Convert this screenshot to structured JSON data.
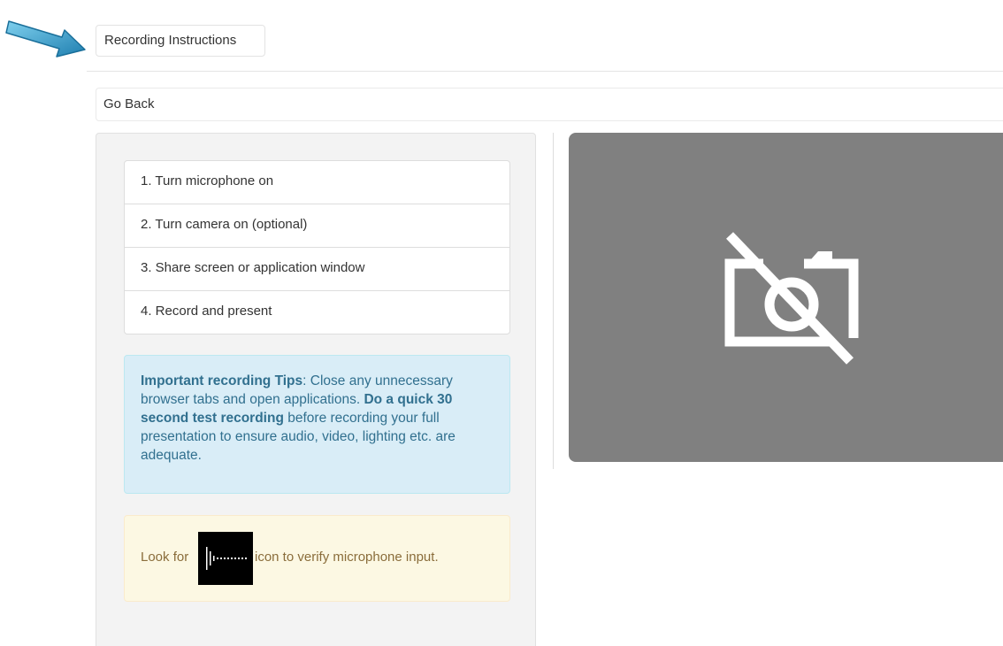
{
  "header": {
    "recording_instructions_label": "Recording Instructions"
  },
  "nav": {
    "go_back_label": "Go Back"
  },
  "steps": [
    "1. Turn microphone on",
    "2. Turn camera on (optional)",
    "3. Share screen or application window",
    "4. Record and present"
  ],
  "tips": {
    "heading": "Important recording Tips",
    "text1": ": Close any unnecessary browser tabs and open applications. ",
    "emphasis": "Do a quick 30 second test recording",
    "text2": " before recording your full presentation to ensure audio, video, lighting etc. are adequate."
  },
  "mic_note": {
    "before_icon": "Look for",
    "after_icon": "icon to verify microphone input.",
    "icon_name": "microphone-level-icon"
  },
  "video": {
    "icon_name": "camera-off-icon",
    "background_color": "#808080"
  },
  "colors": {
    "tips_background": "#d9edf7",
    "tips_text": "#31708f",
    "note_background": "#fcf8e3",
    "note_text": "#8a6d3b",
    "arrow": "#2a8fc0"
  }
}
